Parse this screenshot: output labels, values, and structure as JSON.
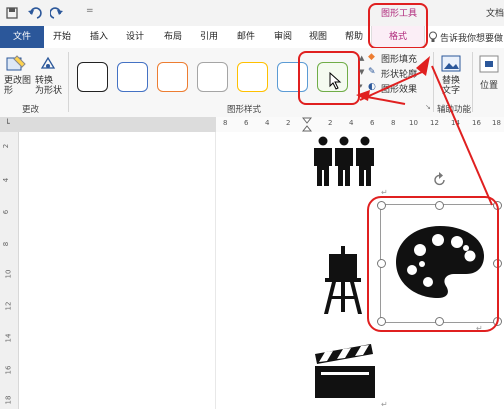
{
  "title_bar": {
    "contextual_tab_group": "图形工具",
    "right_label": "文档"
  },
  "menu": {
    "tabs": [
      "文件",
      "开始",
      "插入",
      "设计",
      "布局",
      "引用",
      "邮件",
      "审阅",
      "视图",
      "帮助",
      "格式"
    ],
    "active": "格式",
    "tell_me": "告诉我你想要做"
  },
  "ribbon": {
    "change_group": {
      "edit_shape": "更改图\n形",
      "convert": "转换\n为形状",
      "label": "更改"
    },
    "shape_styles": {
      "label": "图形样式",
      "swatches": [
        "#222222",
        "#4472c4",
        "#ed7d31",
        "#a5a5a5",
        "#ffc000",
        "#5b9bd5",
        "#70ad47"
      ],
      "fill": "图形填充",
      "outline": "形状轮廓",
      "effects": "图形效果"
    },
    "accessibility": {
      "alt_text": "替换\n文字",
      "label": "辅助功能"
    },
    "position": "位置"
  },
  "ruler": {
    "h_ticks": [
      "8",
      "6",
      "4",
      "2",
      "",
      "2",
      "4",
      "6",
      "8",
      "10",
      "12",
      "14",
      "16",
      "18"
    ],
    "v_ticks": [
      "2",
      "4",
      "6",
      "8",
      "10",
      "12",
      "14",
      "16",
      "18"
    ]
  },
  "colors": {
    "accent": "#2b579a",
    "format_tab": "#b02a7c",
    "highlight": "#e02020"
  },
  "icons": [
    "people-icon",
    "palette-icon",
    "easel-icon",
    "clapperboard-icon"
  ]
}
